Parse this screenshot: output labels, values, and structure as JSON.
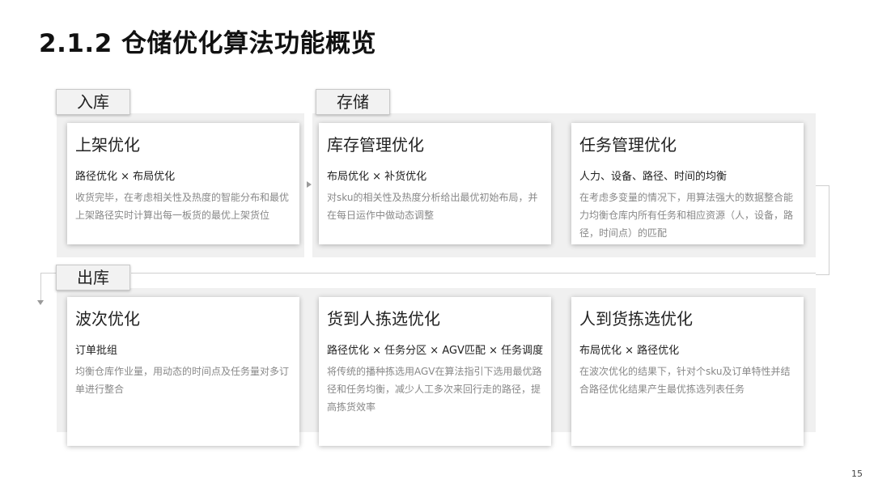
{
  "title": "2.1.2 仓储优化算法功能概览",
  "stages": {
    "inbound": "入库",
    "storage": "存储",
    "outbound": "出库"
  },
  "cards": {
    "putaway": {
      "title": "上架优化",
      "sub": "路径优化 × 布局优化",
      "desc": "收货完毕，在考虑相关性及热度的智能分布和最优上架路径实时计算出每一板货的最优上架货位"
    },
    "inventory": {
      "title": "库存管理优化",
      "sub": "布局优化 × 补货优化",
      "desc": "对sku的相关性及热度分析给出最优初始布局，并在每日运作中做动态调整"
    },
    "task": {
      "title": "任务管理优化",
      "sub": "人力、设备、路径、时间的均衡",
      "desc": "在考虑多变量的情况下，用算法强大的数据整合能力均衡仓库内所有任务和相应资源（人，设备，路径，时间点）的匹配"
    },
    "wave": {
      "title": "波次优化",
      "sub": "订单批组",
      "desc": "均衡仓库作业量，用动态的时间点及任务量对多订单进行整合"
    },
    "goods_to_person": {
      "title": "货到人拣选优化",
      "sub": "路径优化 × 任务分区 × AGV匹配 × 任务调度",
      "desc": "将传统的播种拣选用AGV在算法指引下选用最优路径和任务均衡，减少人工多次来回行走的路径，提高拣货效率"
    },
    "person_to_goods": {
      "title": "人到货拣选优化",
      "sub": "布局优化 × 路径优化",
      "desc": "在波次优化的结果下，针对个sku及订单特性并结合路径优化结果产生最优拣选列表任务"
    }
  },
  "page_number": "15"
}
